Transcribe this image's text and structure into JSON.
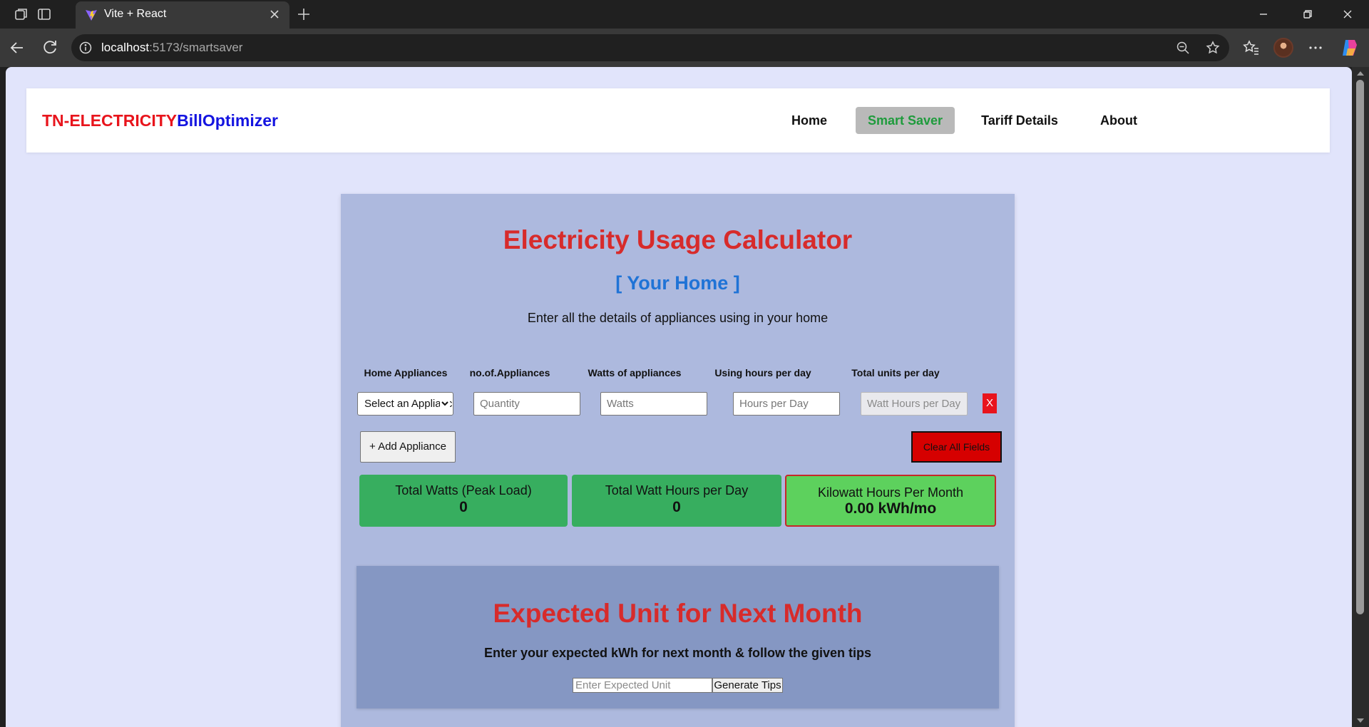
{
  "browser": {
    "tab_title": "Vite + React",
    "url_host": "localhost",
    "url_path": ":5173/smartsaver"
  },
  "navbar": {
    "brand_part1": "TN-ELECTRICITY",
    "brand_part2": "BillOptimizer",
    "links": [
      {
        "label": "Home",
        "active": false
      },
      {
        "label": "Smart Saver",
        "active": true
      },
      {
        "label": "Tariff Details",
        "active": false
      },
      {
        "label": "About",
        "active": false
      }
    ]
  },
  "calculator": {
    "title": "Electricity Usage Calculator",
    "subtitle": "[ Your Home ]",
    "description": "Enter all the details of appliances using in your home",
    "columns": [
      "Home Appliances",
      "no.of.Appliances",
      "Watts of appliances",
      "Using hours per day",
      "Total units per day"
    ],
    "row": {
      "appliance_selected": "Select an Appliance",
      "quantity_placeholder": "Quantity",
      "watts_placeholder": "Watts",
      "hours_placeholder": "Hours per Day",
      "watt_hours_placeholder": "Watt Hours per Day",
      "remove_label": "X"
    },
    "add_button": "+ Add Appliance",
    "clear_button": "Clear All Fields",
    "stats": [
      {
        "label": "Total Watts (Peak Load)",
        "value": "0"
      },
      {
        "label": "Total Watt Hours per Day",
        "value": "0"
      },
      {
        "label": "Kilowatt Hours Per Month",
        "value": "0.00 kWh/mo"
      }
    ]
  },
  "expected": {
    "title": "Expected Unit for Next Month",
    "description": "Enter your expected kWh for next month & follow the given tips",
    "input_placeholder": "Enter Expected Unit",
    "button_label": "Generate Tips"
  },
  "colors": {
    "page_bg": "#e1e4fb",
    "card_bg": "#adb9de",
    "title_red": "#d72b2b",
    "subtitle_blue": "#1f73d6",
    "stat_green": "#37ae5f",
    "stat_green_highlight": "#5dd15d",
    "clear_red": "#d60000",
    "nav_active_green": "#1e9b3c"
  },
  "icons": [
    "workspaces-icon",
    "tab-actions-icon",
    "vite-favicon-icon",
    "close-icon",
    "new-tab-icon",
    "minimize-icon",
    "restore-icon",
    "window-close-icon",
    "back-icon",
    "refresh-icon",
    "info-icon",
    "zoom-out-icon",
    "favorite-star-icon",
    "favorites-icon",
    "more-icon",
    "copilot-icon"
  ]
}
